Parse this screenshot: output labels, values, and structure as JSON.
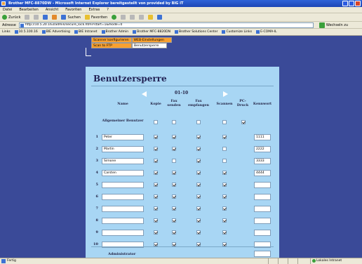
{
  "window": {
    "title": "Brother MFC-8870DW - Microsoft Internet Explorer bereitgestellt von provided by BIG IT"
  },
  "menu": [
    "Datei",
    "Bearbeiten",
    "Ansicht",
    "Favoriten",
    "Extras",
    "?"
  ],
  "toolbar": {
    "back": "Zurück",
    "search": "Suchen",
    "favorites": "Favoriten"
  },
  "address": {
    "label": "Adresse",
    "url": "http://10.5.20.163/admin/secure_lock.html?start=1&mode=0",
    "go": "Wechseln zu"
  },
  "links": {
    "label": "Links",
    "items": [
      "10.5.100.16",
      "BIE Advertising",
      "BIE Intranet",
      "Brother Admin",
      "Brother MFC-8820DN",
      "Brother Solutions Center",
      "Customize Links",
      "E-COMA-IL"
    ]
  },
  "nav": {
    "btn1": "Scanner konfigurieren",
    "btn2": "WEB-Einstellungen",
    "btn3": "Scan to FTP",
    "btn4": "Benutzersperre"
  },
  "panel": {
    "title": "Benutzersperre",
    "range": "01-10",
    "headers": {
      "name": "Name",
      "kopie": "Kopie",
      "fax_senden": "Fax senden",
      "fax_empfangen": "Fax empfangen",
      "scannen": "Scannen",
      "pc_druck": "PC-Druck",
      "kennwort": "Kennwort"
    },
    "general_user": "Allgemeiner Benutzer",
    "admin_label": "Administrator"
  },
  "general_checks": [
    false,
    false,
    false,
    false,
    true
  ],
  "users": [
    {
      "num": "1",
      "name": "Peter",
      "pw": "1111",
      "checks": [
        true,
        true,
        true,
        true
      ]
    },
    {
      "num": "2",
      "name": "Martin",
      "pw": "2222",
      "checks": [
        true,
        true,
        true,
        false
      ]
    },
    {
      "num": "3",
      "name": "Simone",
      "pw": "3333",
      "checks": [
        true,
        false,
        true,
        false
      ]
    },
    {
      "num": "4",
      "name": "Carsten",
      "pw": "4444",
      "checks": [
        true,
        true,
        true,
        true
      ]
    },
    {
      "num": "5",
      "name": "",
      "pw": "",
      "checks": [
        true,
        true,
        true,
        true
      ]
    },
    {
      "num": "6",
      "name": "",
      "pw": "",
      "checks": [
        true,
        true,
        true,
        true
      ]
    },
    {
      "num": "7",
      "name": "",
      "pw": "",
      "checks": [
        true,
        true,
        true,
        true
      ]
    },
    {
      "num": "8",
      "name": "",
      "pw": "",
      "checks": [
        true,
        true,
        true,
        true
      ]
    },
    {
      "num": "9",
      "name": "",
      "pw": "",
      "checks": [
        true,
        true,
        true,
        true
      ]
    },
    {
      "num": "10",
      "name": "",
      "pw": "",
      "checks": [
        true,
        true,
        true,
        true
      ]
    }
  ],
  "status": {
    "text": "Fertig",
    "zone": "Lokales Intranet"
  }
}
